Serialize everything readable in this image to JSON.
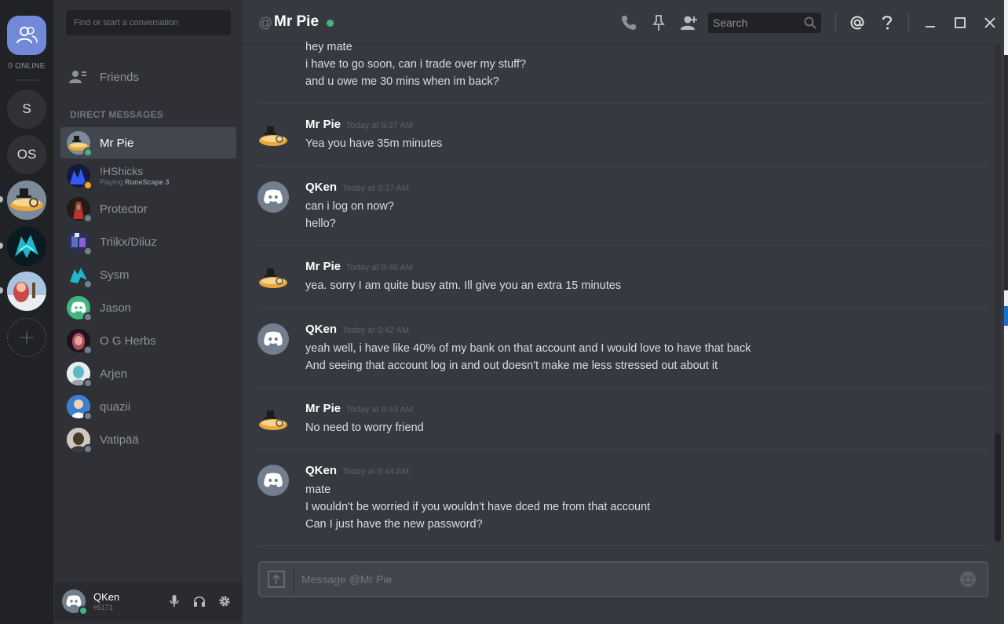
{
  "rail": {
    "online_label": "0 ONLINE",
    "guilds": [
      {
        "label": "S"
      },
      {
        "label": "OS"
      }
    ]
  },
  "sidebar": {
    "search_placeholder": "Find or start a conversation",
    "friends_label": "Friends",
    "dm_header": "DIRECT MESSAGES",
    "dms": [
      {
        "name": "Mr Pie",
        "status": "online",
        "sub": "",
        "sub_game": ""
      },
      {
        "name": "!HShicks",
        "status": "idle",
        "sub": "Playing ",
        "sub_game": "RuneScape 3"
      },
      {
        "name": "Protector",
        "status": "offline",
        "sub": "",
        "sub_game": ""
      },
      {
        "name": "Triikx/Diiuz",
        "status": "offline",
        "sub": "",
        "sub_game": ""
      },
      {
        "name": "Sysm",
        "status": "offline",
        "sub": "",
        "sub_game": ""
      },
      {
        "name": "Jason",
        "status": "offline",
        "sub": "",
        "sub_game": ""
      },
      {
        "name": "O G Herbs",
        "status": "offline",
        "sub": "",
        "sub_game": ""
      },
      {
        "name": "Arjen",
        "status": "offline",
        "sub": "",
        "sub_game": ""
      },
      {
        "name": "quazii",
        "status": "offline",
        "sub": "",
        "sub_game": ""
      },
      {
        "name": "Vatipää",
        "status": "offline",
        "sub": "",
        "sub_game": ""
      }
    ]
  },
  "user_panel": {
    "username": "QKen",
    "tag": "#5171"
  },
  "chat": {
    "at_symbol": "@",
    "title": "Mr Pie",
    "search_placeholder": "Search",
    "composer_placeholder": "Message @Mr Pie",
    "messages": [
      {
        "author": "",
        "time": "",
        "avatar": "none",
        "lines": [
          "hey mate",
          "i have to go soon, can i trade over my stuff?",
          "and u owe me 30 mins when im back?"
        ]
      },
      {
        "author": "Mr Pie",
        "time": "Today at 9:37 AM",
        "avatar": "pie",
        "lines": [
          "Yea you have 35m minutes"
        ]
      },
      {
        "author": "QKen",
        "time": "Today at 9:37 AM",
        "avatar": "discord",
        "lines": [
          "can i log on now?",
          "hello?"
        ]
      },
      {
        "author": "Mr Pie",
        "time": "Today at 9:40 AM",
        "avatar": "pie",
        "lines": [
          "yea. sorry I am quite busy atm. Ill give you an extra 15 minutes"
        ]
      },
      {
        "author": "QKen",
        "time": "Today at 9:42 AM",
        "avatar": "discord",
        "lines": [
          "yeah well, i have like 40% of my bank on that account and I would love to have that back",
          "And seeing that account log in and out doesn't make me less stressed out about it"
        ]
      },
      {
        "author": "Mr Pie",
        "time": "Today at 9:43 AM",
        "avatar": "pie",
        "lines": [
          "No need to worry friend"
        ]
      },
      {
        "author": "QKen",
        "time": "Today at 9:44 AM",
        "avatar": "discord",
        "lines": [
          "mate",
          "I wouldn't be worried if you wouldn't have dced me from that account",
          "Can I just have the new password?"
        ]
      }
    ]
  },
  "colors": {
    "online": "#43b581",
    "idle": "#faa61a",
    "offline": "#747f8d",
    "blurple": "#7289da"
  }
}
